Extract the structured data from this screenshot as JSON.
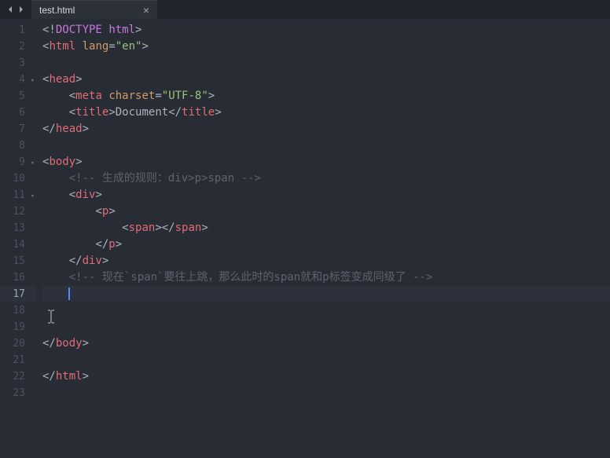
{
  "tab": {
    "filename": "test.html",
    "close_label": "×"
  },
  "nav": {
    "back": "◀",
    "forward": "▶"
  },
  "code": {
    "line1": {
      "a": "<!",
      "b": "DOCTYPE",
      "sp": " ",
      "c": "html",
      "d": ">"
    },
    "line2": {
      "open": "<",
      "tag": "html",
      "sp": " ",
      "attr": "lang",
      "eq": "=",
      "val": "\"en\"",
      "close": ">"
    },
    "line4": {
      "open": "<",
      "tag": "head",
      "close": ">"
    },
    "line5": {
      "open": "<",
      "tag": "meta",
      "sp": " ",
      "attr": "charset",
      "eq": "=",
      "val": "\"UTF-8\"",
      "close": ">"
    },
    "line6": {
      "open": "<",
      "tag": "title",
      "close": ">",
      "text": "Document",
      "open2": "</",
      "tag2": "title",
      "close2": ">"
    },
    "line7": {
      "open": "</",
      "tag": "head",
      "close": ">"
    },
    "line9": {
      "open": "<",
      "tag": "body",
      "close": ">"
    },
    "line10": {
      "comment": "<!-- 生成的规则：div>p>span -->"
    },
    "line11": {
      "open": "<",
      "tag": "div",
      "close": ">"
    },
    "line12": {
      "open": "<",
      "tag": "p",
      "close": ">"
    },
    "line13": {
      "open": "<",
      "tag": "span",
      "close": ">",
      "open2": "</",
      "tag2": "span",
      "close2": ">"
    },
    "line14": {
      "open": "</",
      "tag": "p",
      "close": ">"
    },
    "line15": {
      "open": "</",
      "tag": "div",
      "close": ">"
    },
    "line16": {
      "comment": "<!-- 现在`span`要往上跳，那么此时的span就和p标签变成同级了 -->"
    },
    "line20": {
      "open": "</",
      "tag": "body",
      "close": ">"
    },
    "line22": {
      "open": "</",
      "tag": "html",
      "close": ">"
    }
  },
  "line_count": 23,
  "fold_lines": [
    4,
    9,
    11
  ],
  "highlighted_line": 17
}
